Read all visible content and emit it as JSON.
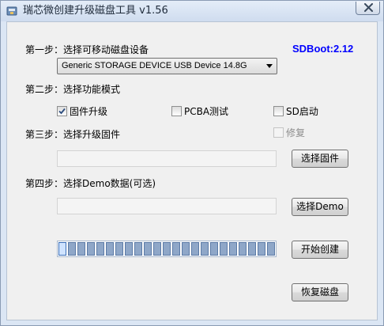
{
  "window": {
    "title": "瑞芯微创建升级磁盘工具 v1.56",
    "icon": "usb-drive-icon",
    "close_icon": "close-icon"
  },
  "version_label": "SDBoot:2.12",
  "step1": {
    "label": "第一步：选择可移动磁盘设备",
    "device_select": {
      "value": "Generic STORAGE DEVICE USB Device     14.8G"
    }
  },
  "step2": {
    "label": "第二步：选择功能模式",
    "options": [
      {
        "label": "固件升级",
        "checked": true,
        "enabled": true
      },
      {
        "label": "PCBA测试",
        "checked": false,
        "enabled": true
      },
      {
        "label": "SD启动",
        "checked": false,
        "enabled": true
      },
      {
        "label": "修复",
        "checked": false,
        "enabled": false
      }
    ]
  },
  "step3": {
    "label": "第三步：选择升级固件",
    "path_value": "",
    "button": "选择固件"
  },
  "step4": {
    "label": "第四步：选择Demo数据(可选)",
    "path_value": "",
    "button": "选择Demo"
  },
  "progress": {
    "segments": 23,
    "active_segments": 1
  },
  "actions": {
    "create": "开始创建",
    "restore": "恢复磁盘"
  },
  "colors": {
    "version_text": "#0000ff",
    "progress_segment": "#8fa7c8",
    "titlebar": "#dbe6f4"
  }
}
